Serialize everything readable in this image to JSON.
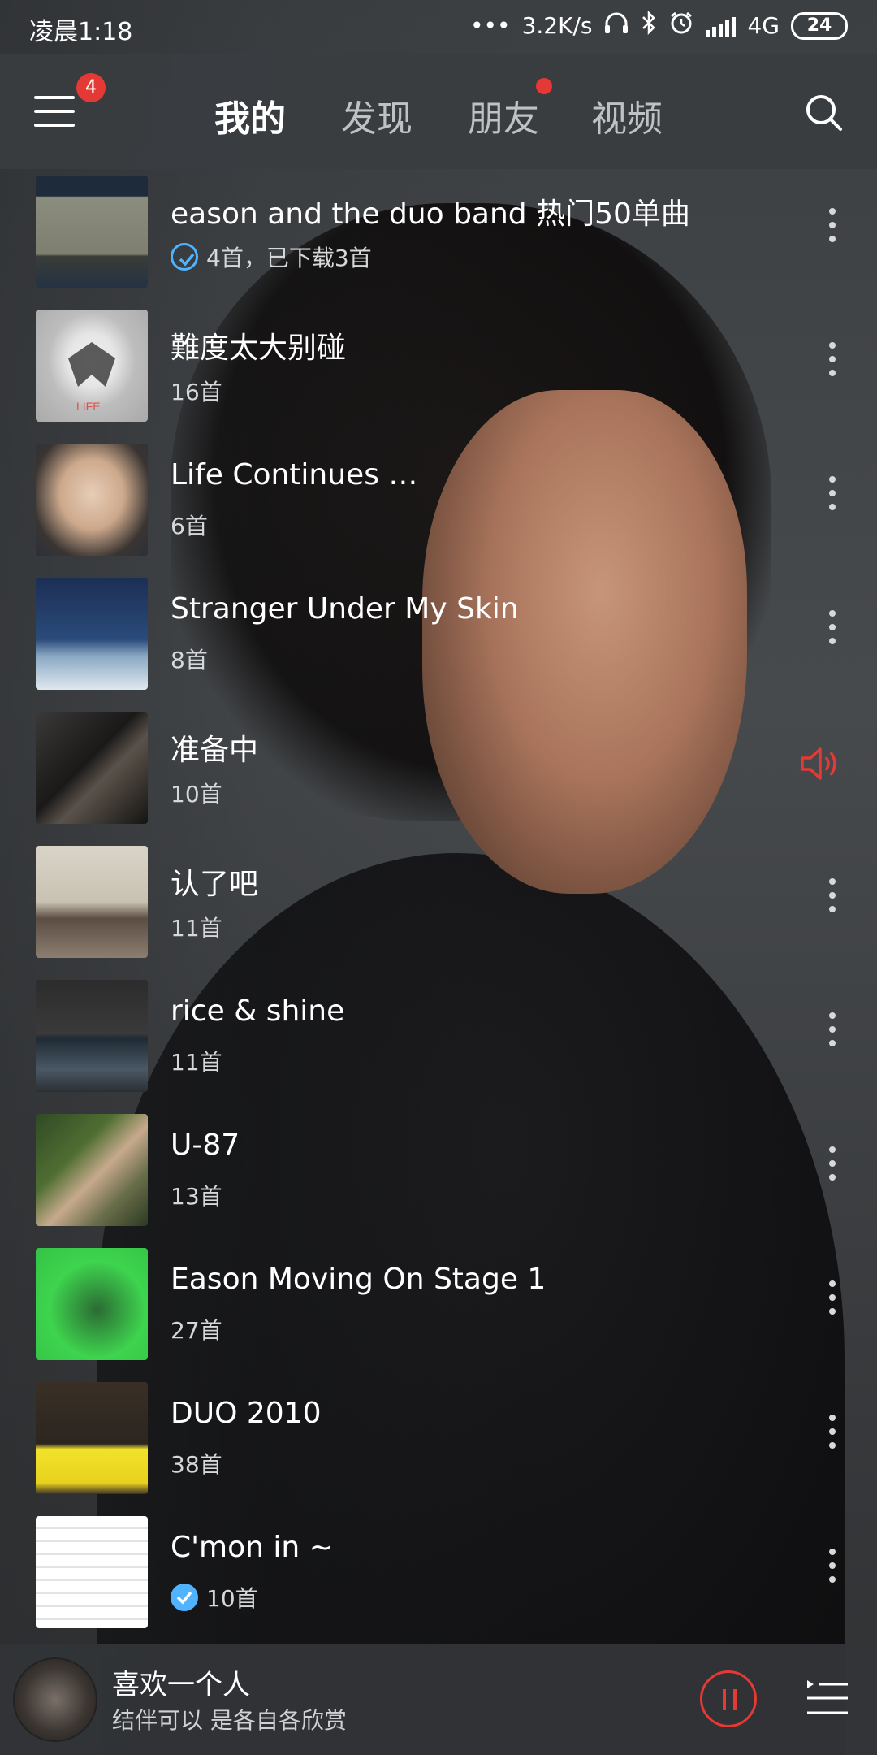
{
  "status_bar": {
    "time": "凌晨1:18",
    "dots": "•••",
    "speed": "3.2K/s",
    "network": "4G",
    "battery": "24"
  },
  "nav": {
    "menu_badge": "4",
    "tabs": [
      "我的",
      "发现",
      "朋友",
      "视频"
    ]
  },
  "albums": [
    {
      "title": "eason and the duo band 热门50单曲",
      "subtitle": "4首，已下载3首",
      "check": "outline"
    },
    {
      "title": "難度太大别碰",
      "subtitle": "16首",
      "check": ""
    },
    {
      "title": "Life Continues …",
      "subtitle": "6首",
      "check": ""
    },
    {
      "title": "Stranger Under My Skin",
      "subtitle": "8首",
      "check": ""
    },
    {
      "title": "准备中",
      "subtitle": "10首",
      "check": "",
      "playing": true
    },
    {
      "title": "认了吧",
      "subtitle": "11首",
      "check": ""
    },
    {
      "title": "rice & shine",
      "subtitle": "11首",
      "check": ""
    },
    {
      "title": "U-87",
      "subtitle": "13首",
      "check": ""
    },
    {
      "title": "Eason Moving On Stage 1",
      "subtitle": "27首",
      "check": ""
    },
    {
      "title": "DUO 2010",
      "subtitle": "38首",
      "check": ""
    },
    {
      "title": "C'mon in ~",
      "subtitle": "10首",
      "check": "filled"
    }
  ],
  "player": {
    "song": "喜欢一个人",
    "artist": "结伴可以 是各自各欣赏"
  },
  "colors": {
    "accent_red": "#e53935",
    "check_blue": "#4fb3ff"
  }
}
